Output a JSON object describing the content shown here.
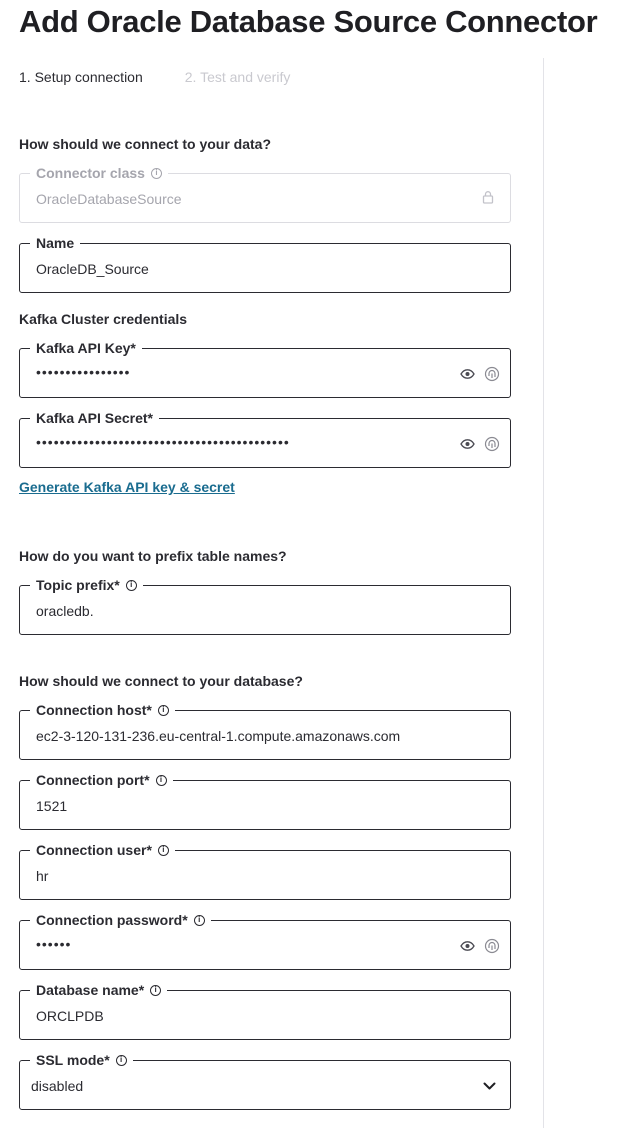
{
  "page": {
    "title": "Add Oracle Database Source Connector",
    "steps": [
      "1. Setup connection",
      "2. Test and verify"
    ]
  },
  "sections": {
    "connect_data": "How should we connect to your data?",
    "kafka_credentials": "Kafka Cluster credentials",
    "prefix": "How do you want to prefix table names?",
    "connect_db": "How should we connect to your database?"
  },
  "fields": {
    "connector_class": {
      "label": "Connector class",
      "value": "OracleDatabaseSource"
    },
    "name": {
      "label": "Name",
      "value": "OracleDB_Source"
    },
    "api_key": {
      "label": "Kafka API Key*",
      "value": "••••••••••••••••"
    },
    "api_secret": {
      "label": "Kafka API Secret*",
      "value": "•••••••••••••••••••••••••••••••••••••••••••"
    },
    "topic_prefix": {
      "label": "Topic prefix*",
      "value": "oracledb."
    },
    "host": {
      "label": "Connection host*",
      "value": "ec2-3-120-131-236.eu-central-1.compute.amazonaws.com"
    },
    "port": {
      "label": "Connection port*",
      "value": "1521"
    },
    "user": {
      "label": "Connection user*",
      "value": "hr"
    },
    "password": {
      "label": "Connection password*",
      "value": "••••••"
    },
    "db_name": {
      "label": "Database name*",
      "value": "ORCLPDB"
    },
    "ssl_mode": {
      "label": "SSL mode*",
      "value": "disabled"
    }
  },
  "links": {
    "generate_key": "Generate Kafka API key & secret"
  },
  "icons": {
    "info": "info-icon",
    "eye": "eye-icon",
    "fingerprint": "fingerprint-icon",
    "lock": "lock-icon",
    "chevron": "chevron-down-icon"
  },
  "colors": {
    "link": "#1a6c8f",
    "text": "#2b2b31",
    "disabled": "#a5a5ad"
  }
}
